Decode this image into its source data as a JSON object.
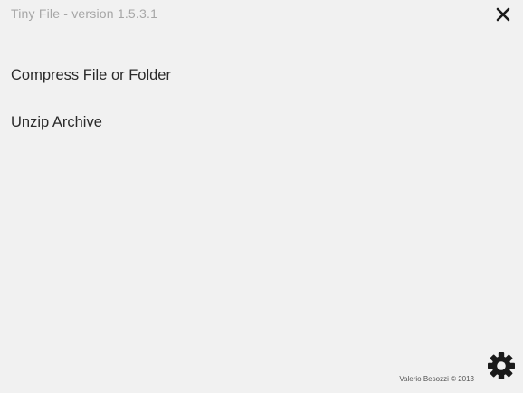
{
  "window": {
    "title": "Tiny File - version 1.5.3.1"
  },
  "menu": {
    "items": [
      {
        "label": "Compress File or Folder"
      },
      {
        "label": "Unzip Archive"
      }
    ]
  },
  "footer": {
    "credit": "Valerio Besozzi © 2013"
  },
  "icons": {
    "close": "close-icon",
    "settings": "gear-icon"
  },
  "colors": {
    "background": "#f1f1f1",
    "title": "#a6a6a6",
    "text": "#2a2a2a",
    "icon": "#1a1a1a"
  }
}
